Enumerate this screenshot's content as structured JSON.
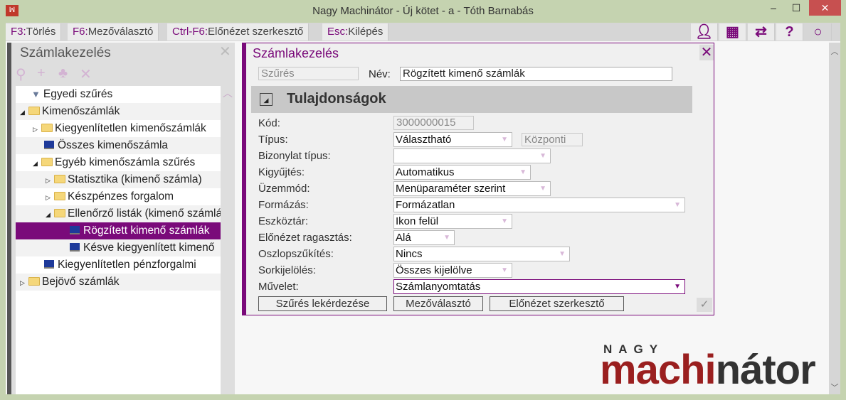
{
  "window": {
    "title": "Nagy Machinátor - Új kötet - a - Tóth Barnabás",
    "minimize": "–",
    "maximize": "☐",
    "close": "✕"
  },
  "toolbar": {
    "items": [
      {
        "key": "F3:",
        "label": "Törlés"
      },
      {
        "key": "F6:",
        "label": "Mezőválasztó"
      },
      {
        "key": "Ctrl-F6:",
        "label": "Előnézet szerkesztő"
      },
      {
        "key": "Esc:",
        "label": "Kilépés"
      }
    ]
  },
  "left_panel": {
    "title": "Számlakezelés",
    "close": "✕",
    "tree": [
      {
        "label": "Egyedi szűrés",
        "icon": "filter"
      },
      {
        "label": "Kimenőszámlák",
        "icon": "folder",
        "expanded": true
      },
      {
        "label": "Kiegyenlítetlen kimenőszámlák",
        "icon": "folder"
      },
      {
        "label": "Összes kimenőszámla",
        "icon": "monitor"
      },
      {
        "label": "Egyéb kimenőszámla szűrés",
        "icon": "folder",
        "expanded": true
      },
      {
        "label": "Statisztika (kimenő számla)",
        "icon": "folder"
      },
      {
        "label": "Készpénzes forgalom",
        "icon": "folder"
      },
      {
        "label": "Ellenőrző listák (kimenő számlák)",
        "icon": "folder",
        "expanded": true
      },
      {
        "label": "Rögzített kimenő számlák",
        "icon": "monitor",
        "selected": true
      },
      {
        "label": "Késve kiegyenlített kimenő",
        "icon": "monitor"
      },
      {
        "label": "Kiegyenlítetlen pénzforgalmi",
        "icon": "monitor"
      },
      {
        "label": "Bejövő számlák",
        "icon": "folder"
      }
    ]
  },
  "dialog": {
    "title": "Számlakezelés",
    "close": "✕",
    "filter_field": "Szűrés",
    "name_label": "Név:",
    "name_value": "Rögzített kimenő számlák",
    "section": "Tulajdonságok",
    "section_toggle": "◢",
    "fields": [
      {
        "label": "Kód:",
        "value": "3000000015"
      },
      {
        "label": "Típus:",
        "value": "Választható",
        "extra": "Központi"
      },
      {
        "label": "Bizonylat típus:",
        "value": ""
      },
      {
        "label": "Kigyűjtés:",
        "value": "Automatikus"
      },
      {
        "label": "Üzemmód:",
        "value": "Menüparaméter szerint"
      },
      {
        "label": "Formázás:",
        "value": "Formázatlan"
      },
      {
        "label": "Eszköztár:",
        "value": "Ikon felül"
      },
      {
        "label": "Előnézet ragasztás:",
        "value": "Alá"
      },
      {
        "label": "Oszlopszűkítés:",
        "value": "Nincs"
      },
      {
        "label": "Sorkijelölés:",
        "value": "Összes kijelölve"
      },
      {
        "label": "Művelet:",
        "value": "Számlanyomtatás"
      }
    ],
    "buttons": {
      "query": "Szűrés lekérdezése",
      "field_chooser": "Mezőválasztó",
      "preview_editor": "Előnézet szerkesztő"
    },
    "check": "✓"
  },
  "logo": {
    "top": "NAGY",
    "main_a": "machi",
    "main_b": "nátor"
  },
  "colors": {
    "accent": "#7a0a7a",
    "frame": "#c5d3b0"
  }
}
